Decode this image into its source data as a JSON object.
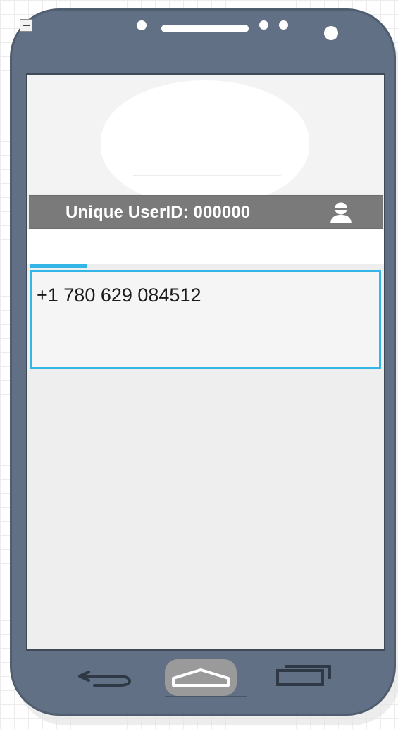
{
  "header": {
    "user_id_label": "Unique UserID: 000000"
  },
  "phone_field": {
    "value": "+1 780 629 084512"
  },
  "icons": {
    "collapse": "minus-icon",
    "user": "user-avatar-icon",
    "back": "back-arrow-icon",
    "home": "home-icon",
    "recent": "recent-apps-icon"
  },
  "colors": {
    "device_frame": "#617084",
    "accent": "#33b5e5",
    "header_bar": "#7a7a7a",
    "screen_background": "#eeeeee"
  }
}
